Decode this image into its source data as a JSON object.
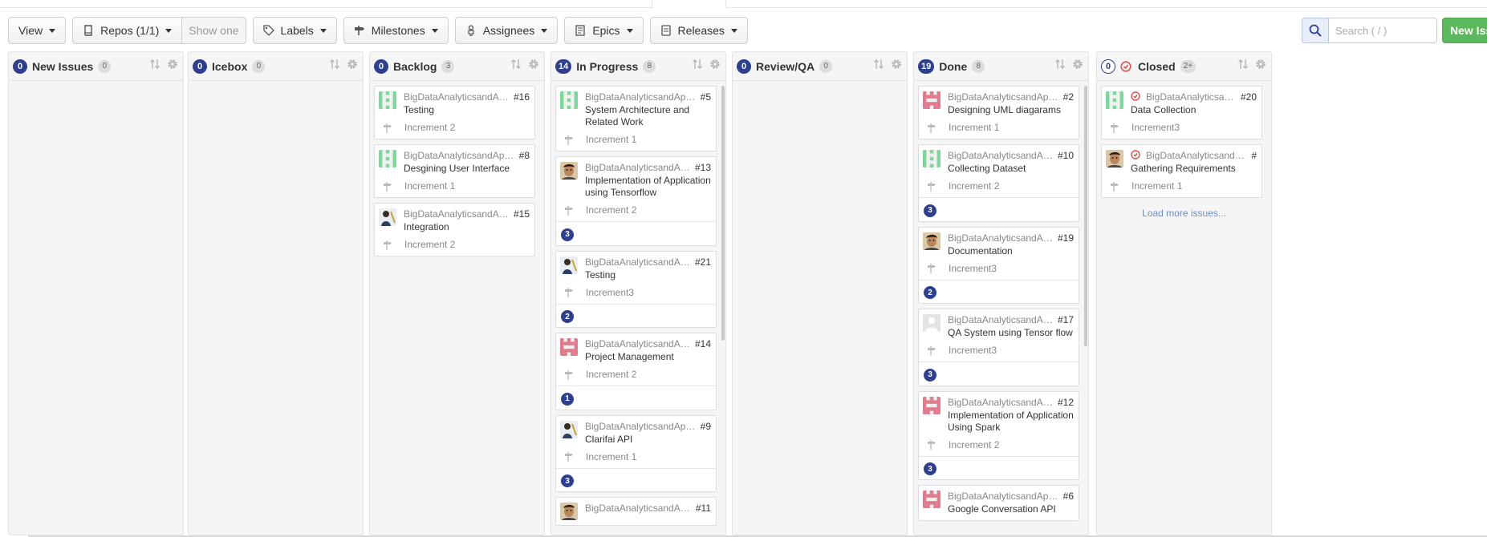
{
  "toolbar": {
    "view": "View",
    "repos": "Repos (1/1)",
    "show_one": "Show one",
    "labels": "Labels",
    "milestones": "Milestones",
    "assignees": "Assignees",
    "epics": "Epics",
    "releases": "Releases"
  },
  "search": {
    "placeholder": "Search ( / )"
  },
  "new_issue": "New Issue",
  "colors": {
    "accent": "#2e3f8f",
    "new_issue_bg": "#5cb85c",
    "closed_icon": "#d9534f",
    "link": "#6a8fc8"
  },
  "columns": [
    {
      "title": "New Issues",
      "issue_count": "0",
      "count": "0",
      "cards": []
    },
    {
      "title": "Icebox",
      "issue_count": "0",
      "count": "0",
      "cards": []
    },
    {
      "title": "Backlog",
      "issue_count": "0",
      "count": "3",
      "cards": [
        {
          "repo": "BigDataAnalyticsandAppsC...",
          "number": "#16",
          "title": "Testing",
          "milestone": "Increment 2",
          "avatar": "identicon-green"
        },
        {
          "repo": "BigDataAnalyticsandAppsCS...",
          "number": "#8",
          "title": "Desgining User Interface",
          "milestone": "Increment 1",
          "avatar": "identicon-green"
        },
        {
          "repo": "BigDataAnalyticsandAppsC...",
          "number": "#15",
          "title": "Integration",
          "milestone": "Increment 2",
          "avatar": "photo-blue"
        }
      ]
    },
    {
      "title": "In Progress",
      "issue_count": "14",
      "count": "8",
      "cards": [
        {
          "repo": "BigDataAnalyticsandAppsCS...",
          "number": "#5",
          "title": "System Architecture and Related Work",
          "milestone": "Increment 1",
          "avatar": "identicon-green"
        },
        {
          "repo": "BigDataAnalyticsandAppsC...",
          "number": "#13",
          "title": "Implementation of Application using Tensorflow",
          "milestone": "Increment 2",
          "avatar": "photo-face",
          "estimate": "3"
        },
        {
          "repo": "BigDataAnalyticsandAppsC...",
          "number": "#21",
          "title": "Testing",
          "milestone": "Increment3",
          "avatar": "photo-blue",
          "estimate": "2"
        },
        {
          "repo": "BigDataAnalyticsandAppsC...",
          "number": "#14",
          "title": "Project Management",
          "milestone": "Increment 2",
          "avatar": "identicon-pink",
          "estimate": "1"
        },
        {
          "repo": "BigDataAnalyticsandAppsCS...",
          "number": "#9",
          "title": "Clarifai API",
          "milestone": "Increment 1",
          "avatar": "photo-blue",
          "estimate": "3"
        },
        {
          "repo": "BigDataAnalyticsandAppsC...",
          "number": "#11",
          "title": "",
          "milestone": "",
          "avatar": "photo-face"
        }
      ]
    },
    {
      "title": "Review/QA",
      "issue_count": "0",
      "count": "0",
      "cards": []
    },
    {
      "title": "Done",
      "issue_count": "19",
      "count": "8",
      "cards": [
        {
          "repo": "BigDataAnalyticsandAppsCS...",
          "number": "#2",
          "title": "Designing UML diagarams",
          "milestone": "Increment 1",
          "avatar": "identicon-pink"
        },
        {
          "repo": "BigDataAnalyticsandAppsC...",
          "number": "#10",
          "title": "Collecting Dataset",
          "milestone": "Increment 2",
          "avatar": "identicon-green",
          "estimate": "3"
        },
        {
          "repo": "BigDataAnalyticsandAppsC...",
          "number": "#19",
          "title": "Documentation",
          "milestone": "Increment3",
          "avatar": "photo-face",
          "estimate": "2"
        },
        {
          "repo": "BigDataAnalyticsandAppsC...",
          "number": "#17",
          "title": "QA System using Tensor flow",
          "milestone": "Increment3",
          "avatar": "default-gray",
          "estimate": "3"
        },
        {
          "repo": "BigDataAnalyticsandAppsC...",
          "number": "#12",
          "title": "Implementation of Application Using Spark",
          "milestone": "Increment 2",
          "avatar": "identicon-pink",
          "estimate": "3"
        },
        {
          "repo": "BigDataAnalyticsandAppsCS...",
          "number": "#6",
          "title": "Google Conversation API",
          "milestone": "",
          "avatar": "identicon-pink"
        }
      ]
    },
    {
      "title": "Closed",
      "issue_count": "0",
      "count": "2+",
      "cards": [
        {
          "repo": "BigDataAnalyticsandAppsC...",
          "number": "#20",
          "title": "Data Collection",
          "milestone": "Increment3",
          "avatar": "identicon-green",
          "closed": true
        },
        {
          "repo": "BigDataAnalyticsandAppsCS...",
          "number": "#",
          "title": "Gathering Requirements",
          "milestone": "Increment 1",
          "avatar": "photo-face",
          "closed": true
        }
      ],
      "load_more": "Load more issues..."
    }
  ]
}
